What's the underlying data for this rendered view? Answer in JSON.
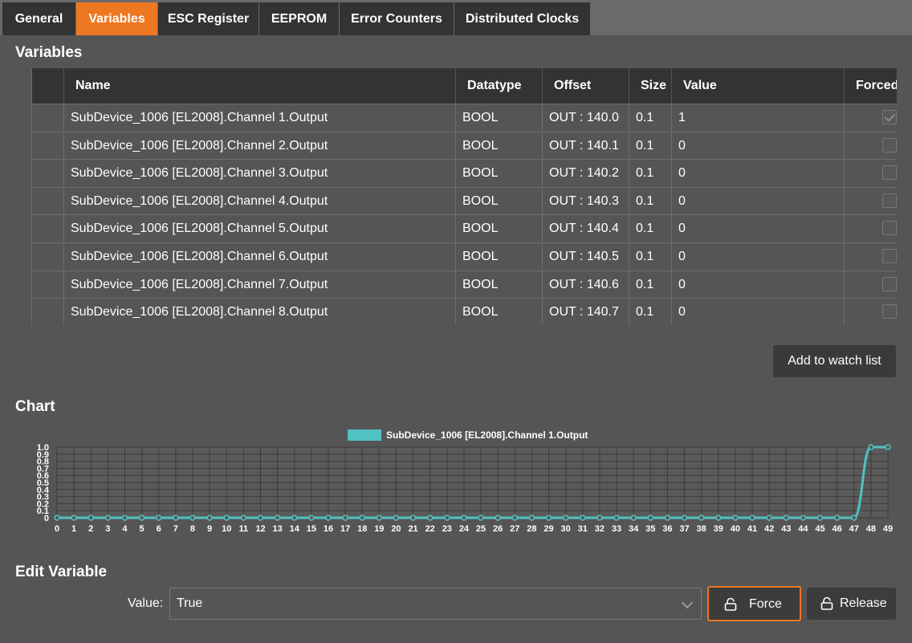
{
  "tabs": [
    {
      "label": "General"
    },
    {
      "label": "Variables"
    },
    {
      "label": "ESC Register"
    },
    {
      "label": "EEPROM"
    },
    {
      "label": "Error Counters"
    },
    {
      "label": "Distributed Clocks"
    }
  ],
  "variables": {
    "title": "Variables",
    "columns": {
      "name": "Name",
      "datatype": "Datatype",
      "offset": "Offset",
      "size": "Size",
      "value": "Value",
      "forced": "Forced"
    },
    "rows": [
      {
        "name": "SubDevice_1006 [EL2008].Channel 1.Output",
        "datatype": "BOOL",
        "offset": "OUT : 140.0",
        "size": "0.1",
        "value": "1",
        "forced": true
      },
      {
        "name": "SubDevice_1006 [EL2008].Channel 2.Output",
        "datatype": "BOOL",
        "offset": "OUT : 140.1",
        "size": "0.1",
        "value": "0",
        "forced": false
      },
      {
        "name": "SubDevice_1006 [EL2008].Channel 3.Output",
        "datatype": "BOOL",
        "offset": "OUT : 140.2",
        "size": "0.1",
        "value": "0",
        "forced": false
      },
      {
        "name": "SubDevice_1006 [EL2008].Channel 4.Output",
        "datatype": "BOOL",
        "offset": "OUT : 140.3",
        "size": "0.1",
        "value": "0",
        "forced": false
      },
      {
        "name": "SubDevice_1006 [EL2008].Channel 5.Output",
        "datatype": "BOOL",
        "offset": "OUT : 140.4",
        "size": "0.1",
        "value": "0",
        "forced": false
      },
      {
        "name": "SubDevice_1006 [EL2008].Channel 6.Output",
        "datatype": "BOOL",
        "offset": "OUT : 140.5",
        "size": "0.1",
        "value": "0",
        "forced": false
      },
      {
        "name": "SubDevice_1006 [EL2008].Channel 7.Output",
        "datatype": "BOOL",
        "offset": "OUT : 140.6",
        "size": "0.1",
        "value": "0",
        "forced": false
      },
      {
        "name": "SubDevice_1006 [EL2008].Channel 8.Output",
        "datatype": "BOOL",
        "offset": "OUT : 140.7",
        "size": "0.1",
        "value": "0",
        "forced": false
      }
    ],
    "add_to_watch_label": "Add to watch list"
  },
  "chart": {
    "title": "Chart"
  },
  "chart_data": {
    "type": "line",
    "x": [
      0,
      1,
      2,
      3,
      4,
      5,
      6,
      7,
      8,
      9,
      10,
      11,
      12,
      13,
      14,
      15,
      16,
      17,
      18,
      19,
      20,
      21,
      22,
      23,
      24,
      25,
      26,
      27,
      28,
      29,
      30,
      31,
      32,
      33,
      34,
      35,
      36,
      37,
      38,
      39,
      40,
      41,
      42,
      43,
      44,
      45,
      46,
      47,
      48,
      49
    ],
    "series": [
      {
        "name": "SubDevice_1006 [EL2008].Channel 1.Output",
        "values": [
          0,
          0,
          0,
          0,
          0,
          0,
          0,
          0,
          0,
          0,
          0,
          0,
          0,
          0,
          0,
          0,
          0,
          0,
          0,
          0,
          0,
          0,
          0,
          0,
          0,
          0,
          0,
          0,
          0,
          0,
          0,
          0,
          0,
          0,
          0,
          0,
          0,
          0,
          0,
          0,
          0,
          0,
          0,
          0,
          0,
          0,
          0,
          0,
          1,
          1
        ],
        "color": "#4fc3c3"
      }
    ],
    "yticks": [
      "0",
      "0.1",
      "0.2",
      "0.3",
      "0.4",
      "0.5",
      "0.6",
      "0.7",
      "0.8",
      "0.9",
      "1.0"
    ],
    "ylim": [
      0,
      1
    ],
    "xlim": [
      0,
      49
    ],
    "grid": true,
    "legend": "top-center"
  },
  "edit": {
    "title": "Edit Variable",
    "value_label": "Value:",
    "value_selected": "True",
    "force_label": "Force",
    "release_label": "Release"
  },
  "colors": {
    "accent": "#ee7722",
    "series": "#4fc3c3",
    "background": "#555555",
    "header": "#333333"
  }
}
